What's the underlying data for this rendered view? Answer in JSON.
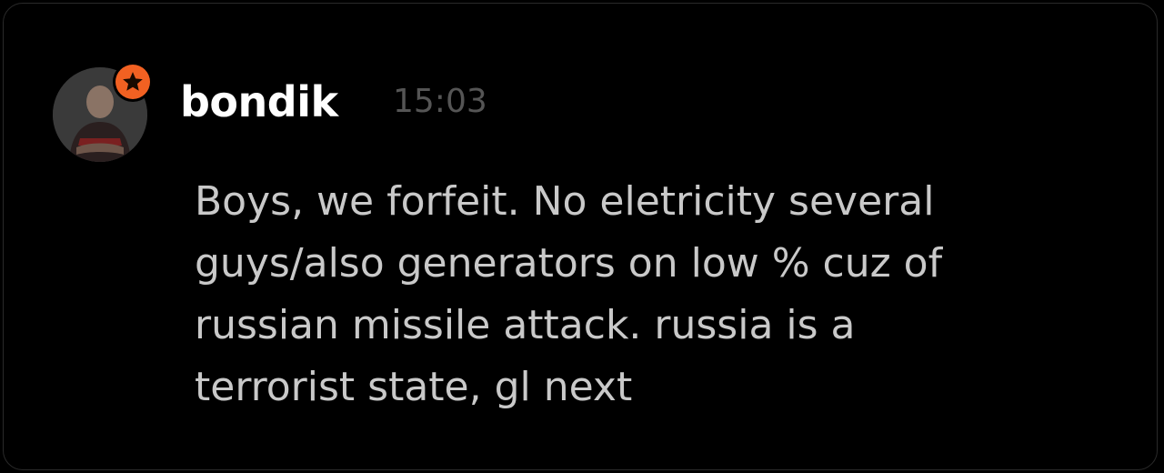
{
  "message": {
    "author": "bondik",
    "time": "15:03",
    "lines": [
      "Boys, we forfeit. No eletricity several",
      "guys/also generators on low % cuz of",
      "russian missile attack. russia is a",
      "terrorist state, gl next"
    ]
  },
  "icons": {
    "avatar": "user-avatar",
    "badge": "star-icon"
  },
  "colors": {
    "background": "#000000",
    "username": "#ffffff",
    "timestamp": "#555555",
    "message_text": "#c9c9c9",
    "badge": "#f26122"
  }
}
